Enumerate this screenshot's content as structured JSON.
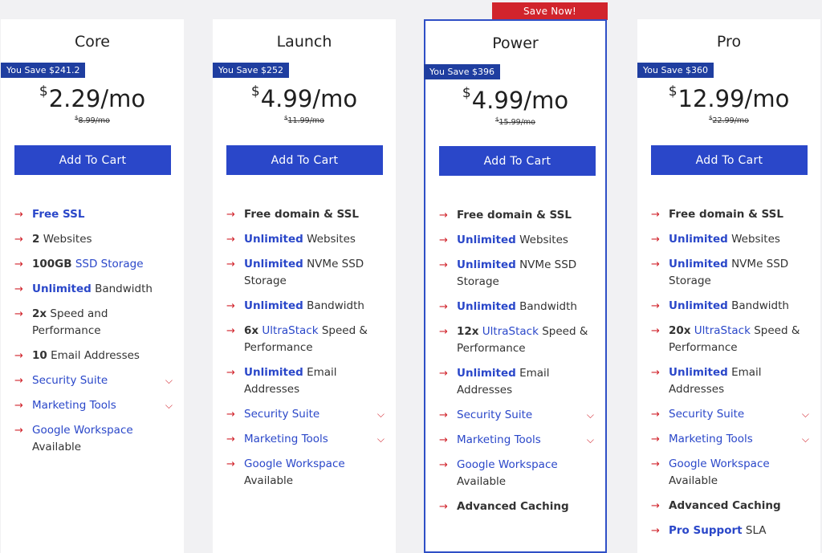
{
  "badge": "Save Now!",
  "cart_label": "Add To Cart",
  "plans": [
    {
      "name": "Core",
      "save": "You Save $241.2",
      "currency": "$",
      "price": "2.29",
      "per": "/mo",
      "old_currency": "$",
      "old_price": "8.99/mo",
      "features": [
        {
          "blue_bold": "Free SSL"
        },
        {
          "bold": "2",
          "text": " Websites"
        },
        {
          "bold": "100GB",
          "link": " SSD Storage"
        },
        {
          "blue_bold": "Unlimited",
          "text": " Bandwidth"
        },
        {
          "bold": "2x",
          "text": " Speed and Performance"
        },
        {
          "bold": "10",
          "text": " Email Addresses"
        },
        {
          "link": "Security Suite",
          "dropdown": true
        },
        {
          "link": " Marketing Tools",
          "dropdown": true
        },
        {
          "link": "Google Workspace",
          "text": " Available"
        }
      ]
    },
    {
      "name": "Launch",
      "save": "You Save $252",
      "currency": "$",
      "price": "4.99",
      "per": "/mo",
      "old_currency": "$",
      "old_price": "11.99/mo",
      "features": [
        {
          "bold": "Free domain & SSL"
        },
        {
          "blue_bold": "Unlimited",
          "text": " Websites"
        },
        {
          "blue_bold": "Unlimited",
          "text": " NVMe SSD Storage"
        },
        {
          "blue_bold": "Unlimited",
          "text": " Bandwidth"
        },
        {
          "bold": "6x",
          "link": " UltraStack",
          "text": " Speed & Performance"
        },
        {
          "blue_bold": "Unlimited",
          "text": " Email Addresses"
        },
        {
          "link": "Security Suite",
          "dropdown": true
        },
        {
          "link": " Marketing Tools",
          "dropdown": true
        },
        {
          "link": "Google Workspace",
          "text": " Available"
        }
      ]
    },
    {
      "name": "Power",
      "save": "You Save $396",
      "currency": "$",
      "price": "4.99",
      "per": "/mo",
      "old_currency": "$",
      "old_price": "15.99/mo",
      "features": [
        {
          "bold": "Free domain & SSL"
        },
        {
          "blue_bold": "Unlimited",
          "text": " Websites"
        },
        {
          "blue_bold": "Unlimited",
          "text": " NVMe SSD Storage"
        },
        {
          "blue_bold": "Unlimited",
          "text": " Bandwidth"
        },
        {
          "bold": "12x",
          "link": " UltraStack",
          "text": " Speed & Performance"
        },
        {
          "blue_bold": "Unlimited",
          "text": " Email Addresses"
        },
        {
          "link": "Security Suite",
          "dropdown": true
        },
        {
          "link": " Marketing Tools",
          "dropdown": true
        },
        {
          "link": "Google Workspace",
          "text": " Available"
        },
        {
          "bold": "Advanced Caching"
        }
      ]
    },
    {
      "name": "Pro",
      "save": "You Save $360",
      "currency": "$",
      "price": "12.99",
      "per": "/mo",
      "old_currency": "$",
      "old_price": "22.99/mo",
      "features": [
        {
          "bold": "Free domain & SSL"
        },
        {
          "blue_bold": "Unlimited",
          "text": " Websites"
        },
        {
          "blue_bold": "Unlimited",
          "text": " NVMe SSD Storage"
        },
        {
          "blue_bold": "Unlimited",
          "text": " Bandwidth"
        },
        {
          "bold": "20x",
          "link": " UltraStack",
          "text": " Speed & Performance"
        },
        {
          "blue_bold": "Unlimited",
          "text": " Email Addresses"
        },
        {
          "link": "Security Suite",
          "dropdown": true
        },
        {
          "link": " Marketing Tools",
          "dropdown": true
        },
        {
          "link": "Google Workspace",
          "text": " Available"
        },
        {
          "bold": "Advanced Caching"
        },
        {
          "blue_bold": "Pro Support",
          "text": " SLA"
        }
      ]
    }
  ],
  "colors": {
    "accent_blue": "#2a47c9",
    "save_tag": "#1f3ea0",
    "badge_red": "#d1242c",
    "arrow_red": "#d1242c"
  },
  "icons": {
    "bullet": "arrow-right-icon",
    "dropdown": "chevron-down-icon"
  }
}
